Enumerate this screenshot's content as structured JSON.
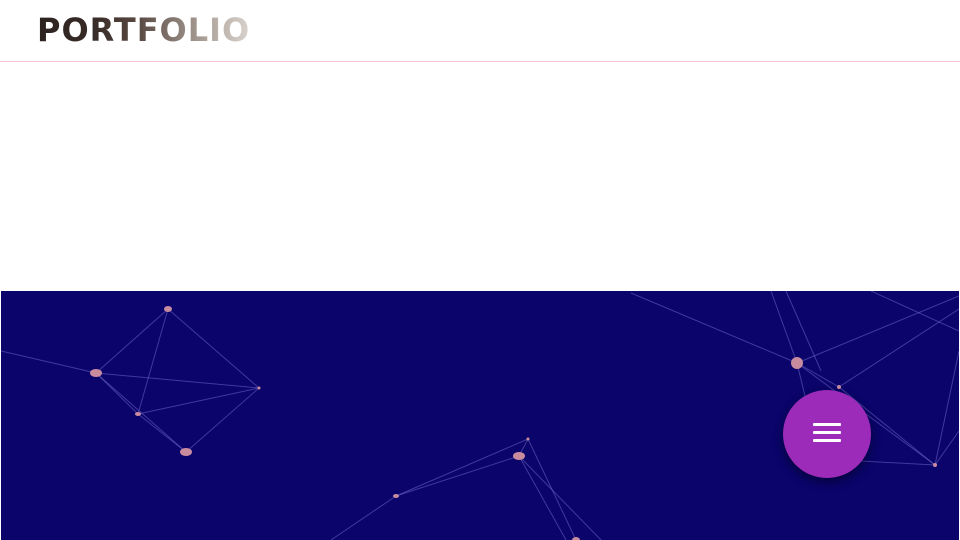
{
  "header": {
    "logo_text": "PORTFOLIO"
  },
  "hero": {
    "background_color": "#0a046b",
    "node_color": "#c98b9e"
  },
  "menu_fab": {
    "icon": "hamburger-menu-icon",
    "color": "#9b2bb8"
  }
}
